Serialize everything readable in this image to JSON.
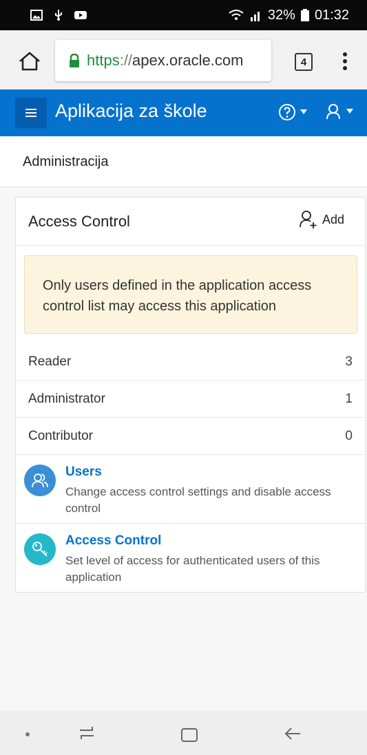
{
  "status_bar": {
    "battery": "32%",
    "time": "01:32"
  },
  "browser": {
    "url_scheme": "https",
    "url_sep": "://",
    "url_host": "apex.oracle.com",
    "tab_count": "4"
  },
  "app": {
    "title": "Aplikacija za škole",
    "accent_color": "#0572ce"
  },
  "breadcrumb": {
    "current": "Administracija"
  },
  "card": {
    "title": "Access Control",
    "add_label": "Add",
    "alert_text": "Only users defined in the application access control list may access this application",
    "counts": [
      {
        "label": "Reader",
        "value": "3"
      },
      {
        "label": "Administrator",
        "value": "1"
      },
      {
        "label": "Contributor",
        "value": "0"
      }
    ],
    "links": [
      {
        "title": "Users",
        "description": "Change access control settings and disable access control",
        "icon": "users-icon",
        "color": "#3a8fd6"
      },
      {
        "title": "Access Control",
        "description": "Set level of access for authenticated users of this application",
        "icon": "key-icon",
        "color": "#26b8c9"
      }
    ]
  }
}
